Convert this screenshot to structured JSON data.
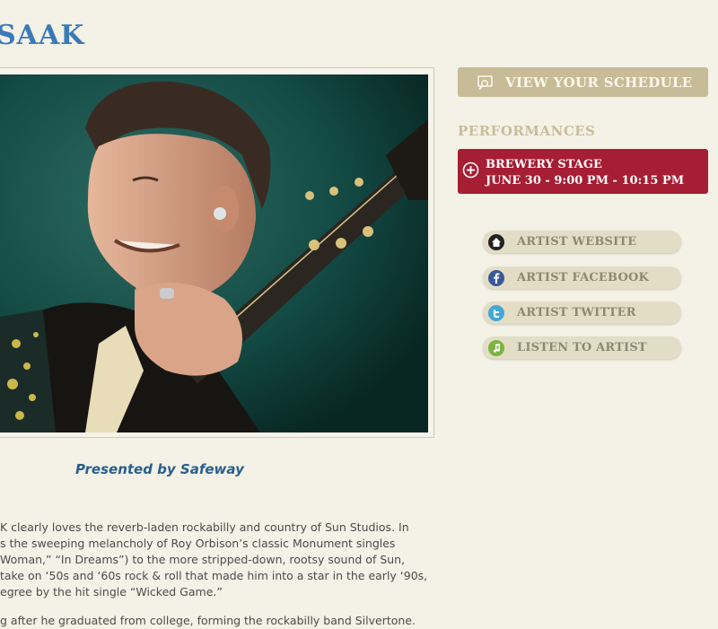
{
  "artist": {
    "name": "SAAK",
    "presented_by": "Presented by Safeway"
  },
  "sidebar": {
    "schedule_label": "VIEW YOUR SCHEDULE",
    "performances_heading": "PERFORMANCES",
    "performance": {
      "stage": "BREWERY STAGE",
      "time": "JUNE 30 - 9:00 PM - 10:15 PM"
    },
    "links": [
      {
        "label": "ARTIST WEBSITE",
        "icon": "home-icon",
        "color": "#222222"
      },
      {
        "label": "ARTIST FACEBOOK",
        "icon": "facebook-icon",
        "color": "#3b5998"
      },
      {
        "label": "ARTIST TWITTER",
        "icon": "twitter-icon",
        "color": "#42a8d8"
      },
      {
        "label": "LISTEN TO ARTIST",
        "icon": "music-note-icon",
        "color": "#7cb342"
      }
    ]
  },
  "bio": {
    "paragraph1_lines": [
      "K clearly loves the reverb-laden rockabilly and country of Sun Studios. In",
      "s the sweeping melancholy of Roy Orbison’s classic Monument singles",
      " Woman,” “In Dreams”) to the more stripped-down, rootsy sound of Sun,",
      "take on ‘50s and ‘60s rock & roll that made him into a star in the early ‘90s,",
      "egree by the hit single “Wicked Game.”"
    ],
    "paragraph2_lines": [
      "g after he graduated from college, forming the rockabilly band Silvertone."
    ]
  },
  "colors": {
    "title": "#3b7ab7",
    "accent_red": "#a51e33",
    "tan_button": "#c7bc97",
    "background": "#f4f1e6"
  }
}
